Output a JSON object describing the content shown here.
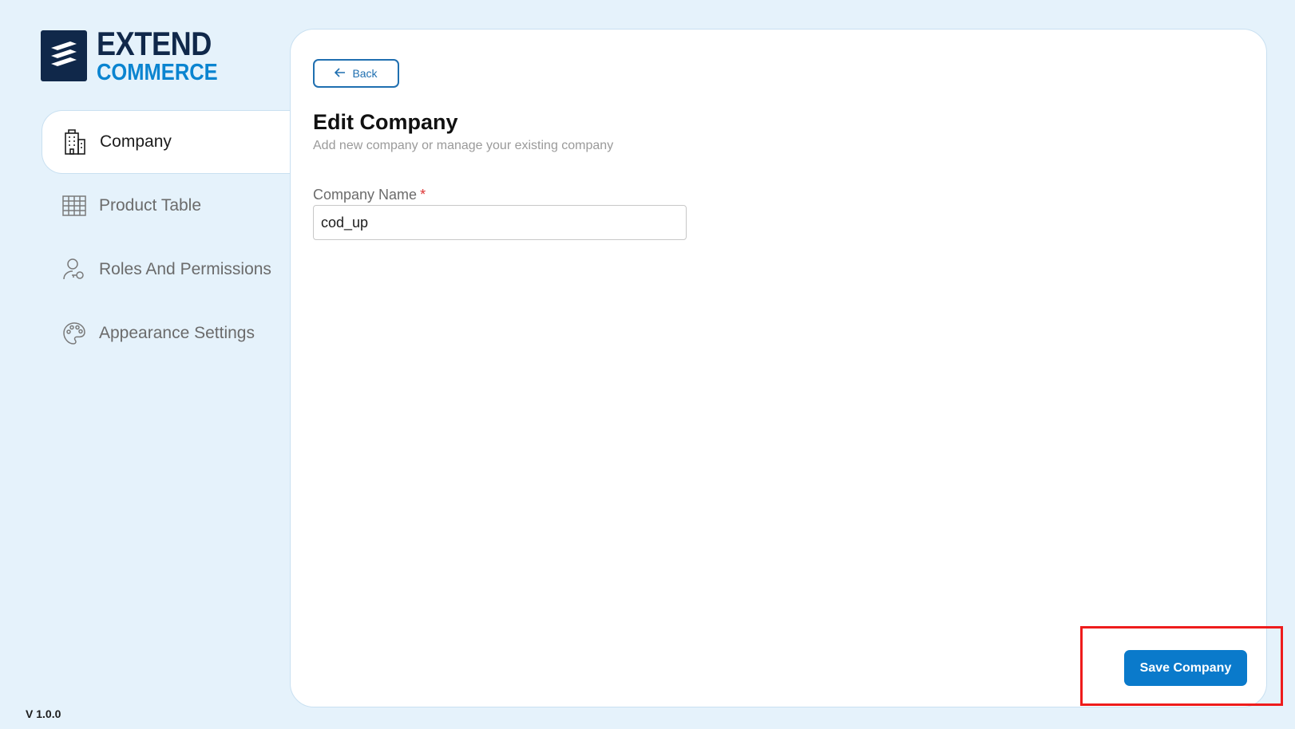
{
  "brand": {
    "line1": "EXTEND",
    "line2": "COMMERCE"
  },
  "sidebar": {
    "items": [
      {
        "label": "Company",
        "icon": "building-icon",
        "active": true
      },
      {
        "label": "Product Table",
        "icon": "table-icon",
        "active": false
      },
      {
        "label": "Roles And Permissions",
        "icon": "user-key-icon",
        "active": false
      },
      {
        "label": "Appearance Settings",
        "icon": "palette-icon",
        "active": false
      }
    ]
  },
  "version": "V 1.0.0",
  "main": {
    "back_label": "Back",
    "title": "Edit Company",
    "subtitle": "Add new company or manage your existing company",
    "form": {
      "company_name_label": "Company Name",
      "required_mark": "*",
      "company_name_value": "cod_up"
    },
    "save_label": "Save Company"
  },
  "colors": {
    "background": "#e5f2fb",
    "brand_dark": "#10284a",
    "brand_accent": "#0a84d0",
    "primary_button": "#0a7acb",
    "highlight": "#ee1c1c"
  }
}
